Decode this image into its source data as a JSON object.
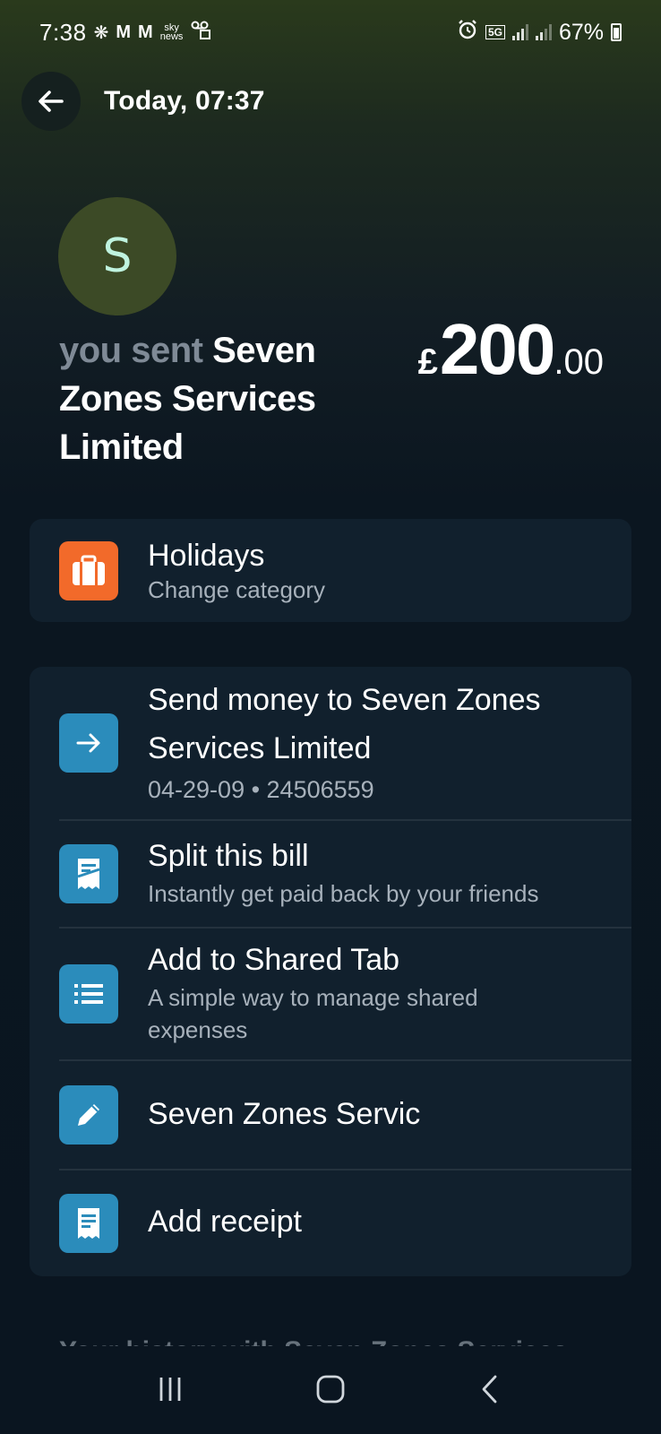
{
  "status_bar": {
    "time": "7:38",
    "left_icons": [
      "❋",
      "M",
      "M"
    ],
    "sky_top": "sky",
    "sky_bottom": "news",
    "battery": "67%",
    "network": "5G"
  },
  "header": {
    "title": "Today, 07:37"
  },
  "avatar": {
    "initial": "S"
  },
  "transaction": {
    "prefix": "you sent",
    "recipient": "Seven Zones Services Limited",
    "currency": "£",
    "amount_main": "200",
    "amount_decimals": ".00"
  },
  "category": {
    "name": "Holidays",
    "action": "Change category",
    "color": "#f26a2a"
  },
  "actions": [
    {
      "title_line1": "Send money to Seven Zones",
      "title_line2": "Services Limited",
      "subtitle": "04-29-09 • 24506559",
      "icon": "arrow-right-icon"
    },
    {
      "title": "Split this bill",
      "subtitle": "Instantly get paid back by your friends",
      "icon": "receipt-split-icon"
    },
    {
      "title": "Add to Shared Tab",
      "subtitle_line1": "A simple way to manage shared",
      "subtitle_line2": "expenses",
      "icon": "list-icon"
    },
    {
      "title": "Seven Zones Servic",
      "icon": "pencil-icon"
    },
    {
      "title": "Add receipt",
      "icon": "receipt-icon"
    }
  ],
  "footer_partial": "Your history with Seven Zones Services",
  "colors": {
    "accent_blue": "#2b8cbb",
    "card_bg": "#11202d",
    "muted_text": "#a7b1bb"
  }
}
